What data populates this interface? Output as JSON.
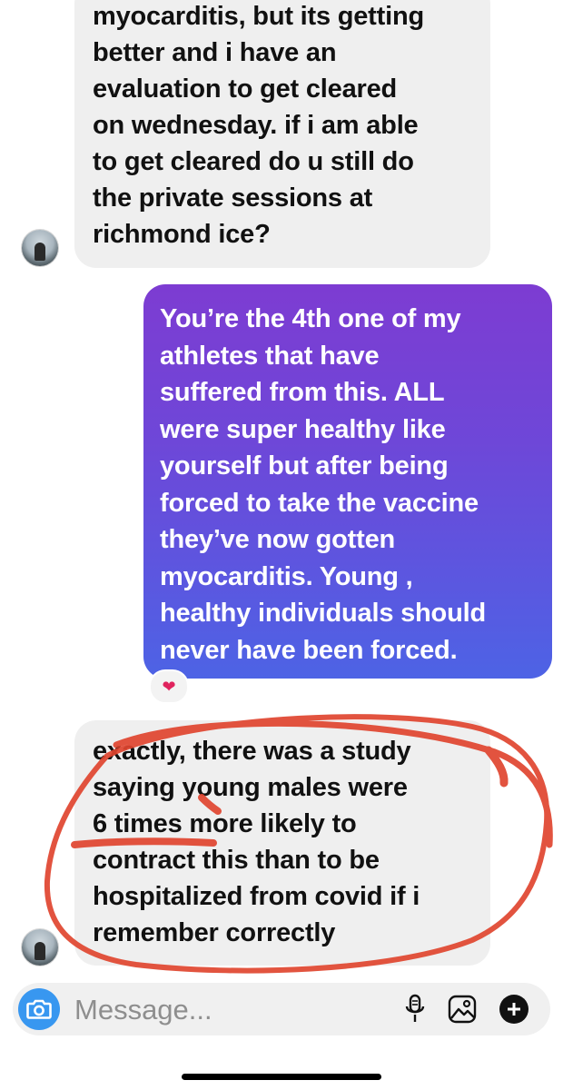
{
  "thread": {
    "incoming_1": {
      "lines": [
        "myocarditis, but its getting",
        "better and i have an",
        "evaluation to get cleared",
        "on wednesday. if i am able",
        "to get cleared do u still do",
        "the private sessions at",
        "richmond ice?"
      ]
    },
    "outgoing_1": {
      "lines": [
        "You’re the 4th one of my",
        "athletes that have",
        "suffered from this. ALL",
        "were super healthy like",
        "yourself but after being",
        "forced to take the vaccine",
        "they’ve now gotten",
        "myocarditis. Young ,",
        "healthy individuals should",
        "never have been forced."
      ],
      "reaction": "❤"
    },
    "incoming_2": {
      "lines": [
        "exactly, there was a study",
        "saying young males were",
        "6 times more likely to",
        "contract this than to be",
        "hospitalized from covid if i",
        "remember correctly"
      ]
    }
  },
  "composer": {
    "placeholder": "Message...",
    "icons": [
      "camera-icon",
      "microphone-icon",
      "gallery-icon",
      "plus-icon"
    ]
  },
  "colors": {
    "incoming_bubble": "#efefef",
    "outgoing_gradient_top": "#7d3cd2",
    "outgoing_gradient_bottom": "#4d63e5",
    "annotation_red": "#e0452f",
    "camera_button": "#3897f0"
  }
}
